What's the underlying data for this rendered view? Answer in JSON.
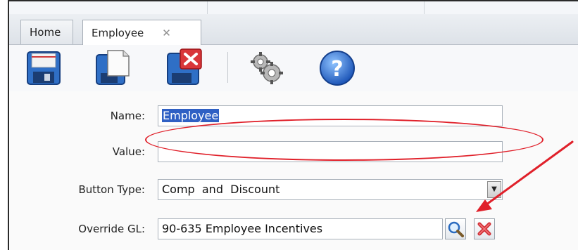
{
  "tabs": [
    {
      "label": "Home",
      "active": false
    },
    {
      "label": "Employee",
      "active": true
    }
  ],
  "tab_close_icon": "close-icon",
  "toolbar": {
    "buttons": [
      {
        "name": "save",
        "icon": "save-disk-icon"
      },
      {
        "name": "save-as",
        "icon": "save-copy-icon"
      },
      {
        "name": "delete",
        "icon": "save-delete-icon"
      },
      {
        "name": "settings",
        "icon": "gears-icon"
      },
      {
        "name": "help",
        "icon": "help-icon"
      }
    ]
  },
  "form": {
    "name_label": "Name:",
    "name_value": "Employee",
    "value_label": "Value:",
    "value_value": "",
    "button_type_label": "Button Type:",
    "button_type_value": "Comp  and  Discount",
    "override_gl_label": "Override GL:",
    "override_gl_value": "90-635 Employee Incentives"
  },
  "annotation": {
    "color": "#e0202a"
  }
}
